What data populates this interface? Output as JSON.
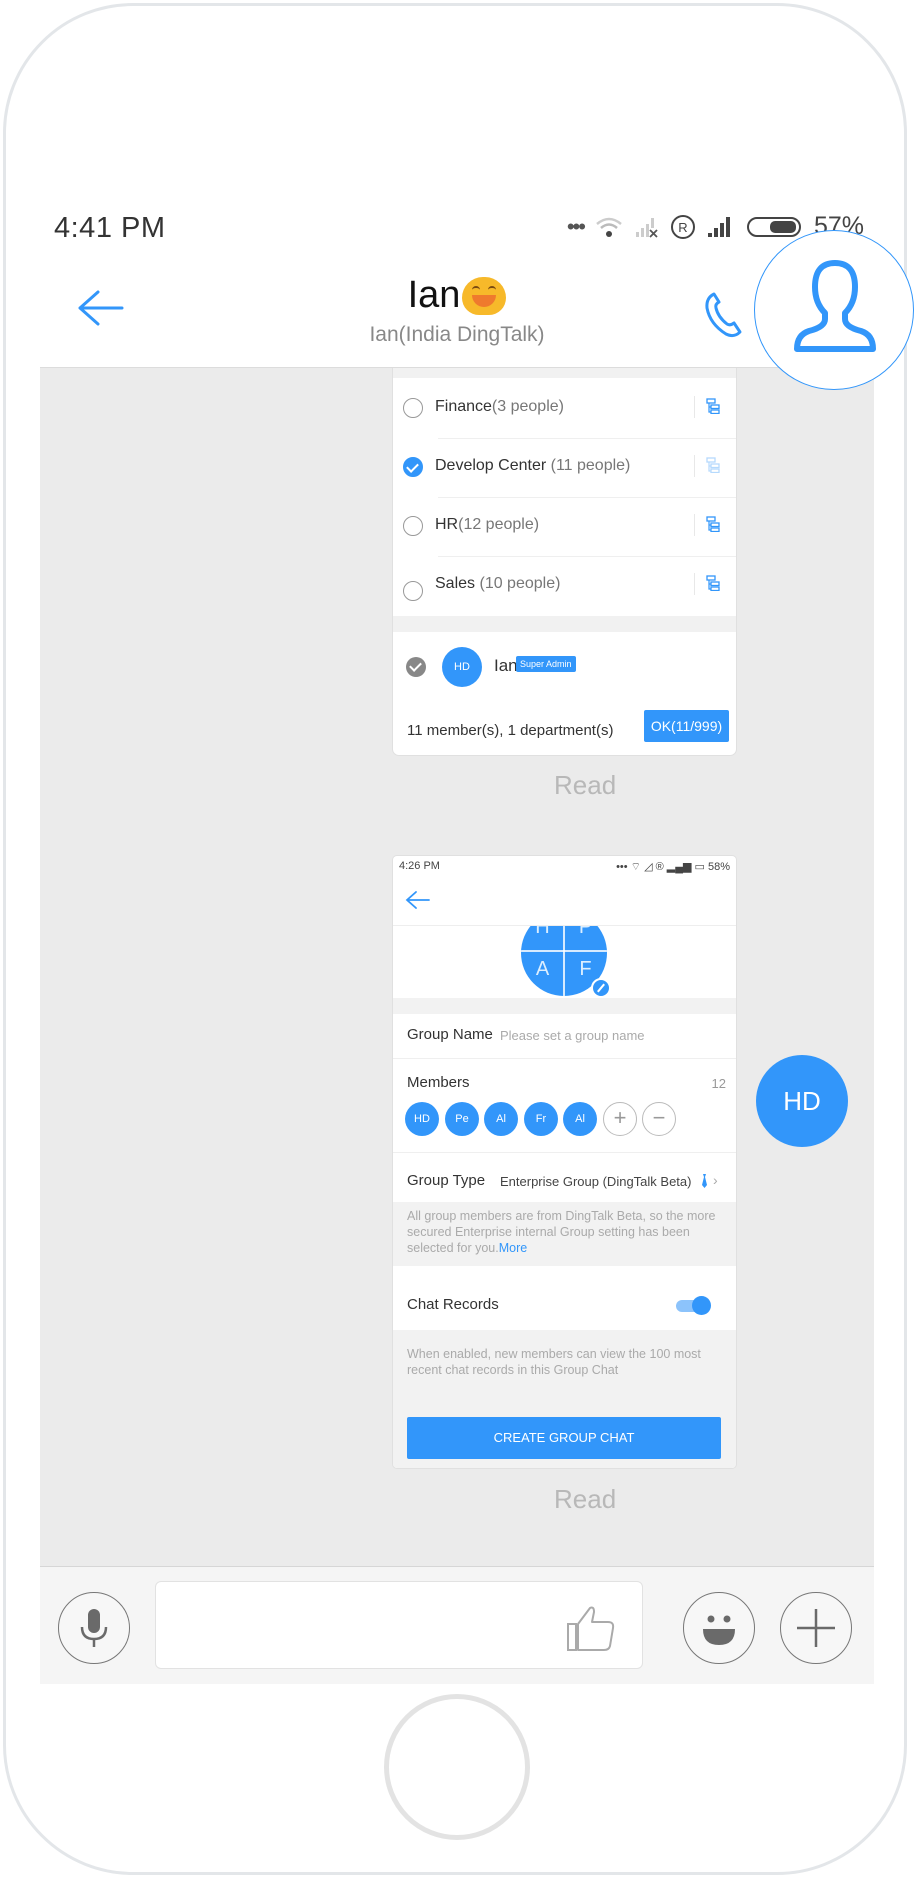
{
  "status_bar": {
    "time": "4:41  PM",
    "icons": [
      "more-dots-icon",
      "wifi-icon",
      "no-signal-icon",
      "roaming-icon",
      "signal-icon",
      "battery-icon"
    ],
    "battery": "57%"
  },
  "header": {
    "title": "Ian",
    "title_emoji": "grinning-face-emoji",
    "subtitle": "Ian(India DingTalk)",
    "back_icon": "arrow-left-icon",
    "call_icon": "phone-icon",
    "profile_icon": "person-icon"
  },
  "messages": [
    {
      "type": "image",
      "screen": "department-picker",
      "departments": [
        {
          "name": "Finance",
          "count": "(3 people)",
          "checked": false
        },
        {
          "name": "Develop Center",
          "count": "(11 people)",
          "checked": true
        },
        {
          "name": "HR",
          "count": "(12 people)",
          "checked": false
        },
        {
          "name": "Sales",
          "count": "(10 people)",
          "checked": false
        }
      ],
      "selected_user": {
        "avatar": "HD",
        "name": "Ian",
        "badge": "Super Admin"
      },
      "summary": "11 member(s), 1 department(s)",
      "ok_button": "OK(11/999)",
      "read_status": "Read"
    },
    {
      "type": "image",
      "screen": "create-group",
      "status_time": "4:26  PM",
      "status_battery": "58%",
      "group_avatar_letters": [
        "H",
        "P",
        "A",
        "F"
      ],
      "group_name_label": "Group Name",
      "group_name_placeholder": "Please set a group name",
      "members_label": "Members",
      "members_count": "12",
      "members": [
        "HD",
        "Pe",
        "Al",
        "Fr",
        "Al"
      ],
      "add_member": "+",
      "remove_member": "−",
      "group_type_label": "Group Type",
      "group_type_value": "Enterprise Group (DingTalk Beta)",
      "group_type_info": "All group members are from DingTalk Beta, so the more secured Enterprise internal Group setting has been selected for you.",
      "group_type_more": "More",
      "chat_records_label": "Chat Records",
      "chat_records_enabled": true,
      "chat_records_hint": "When enabled, new members can view the 100 most recent chat records in this Group Chat",
      "create_button": "CREATE GROUP CHAT",
      "read_status": "Read",
      "sender_avatar": "HD"
    }
  ],
  "input_bar": {
    "voice_icon": "microphone-icon",
    "like_icon": "thumbs-up-icon",
    "emoji_icon": "smiley-icon",
    "more_icon": "plus-icon",
    "input_value": ""
  }
}
